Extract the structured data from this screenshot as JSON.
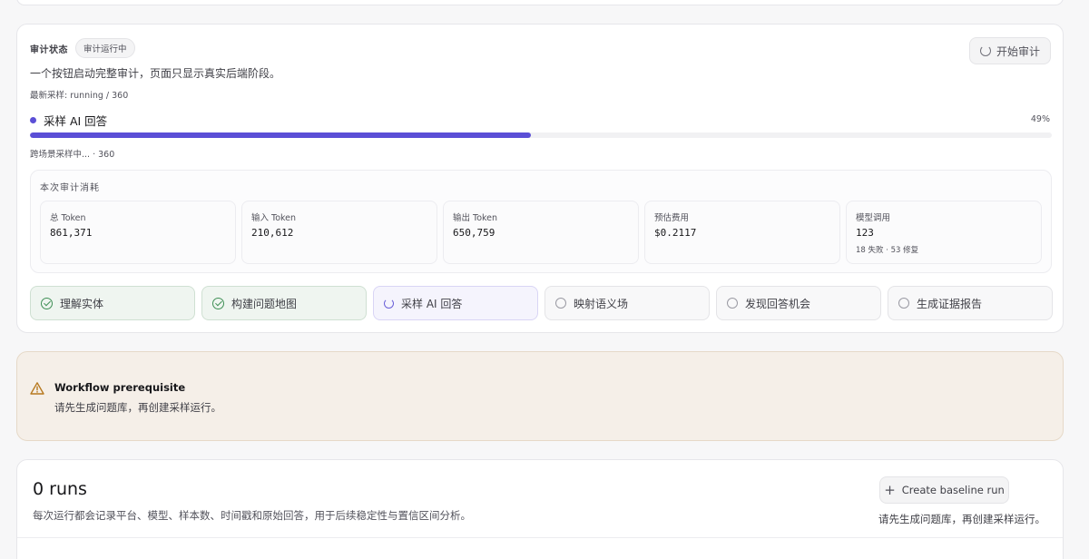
{
  "audit": {
    "status_label": "审计状态",
    "status_badge": "审计运行中",
    "start_button": "开始审计",
    "description": "一个按钮启动完整审计，页面只显示真实后端阶段。",
    "latest_sample": "最新采样: running / 360",
    "current_step": "采样 AI 回答",
    "progress_percent_text": "49%",
    "progress_fraction": 0.49,
    "progress_sub": "跨场景采样中... · 360",
    "consumption": {
      "title": "本次审计消耗",
      "metrics": [
        {
          "label": "总 Token",
          "value": "861,371",
          "sub": ""
        },
        {
          "label": "输入 Token",
          "value": "210,612",
          "sub": ""
        },
        {
          "label": "输出 Token",
          "value": "650,759",
          "sub": ""
        },
        {
          "label": "预估费用",
          "value": "$0.2117",
          "sub": ""
        },
        {
          "label": "模型调用",
          "value": "123",
          "sub": "18 失败 · 53 修复"
        }
      ]
    },
    "steps": [
      {
        "label": "理解实体",
        "state": "done",
        "icon": "check-circle-icon"
      },
      {
        "label": "构建问题地图",
        "state": "done",
        "icon": "check-circle-icon"
      },
      {
        "label": "采样 AI 回答",
        "state": "active",
        "icon": "spinner-icon"
      },
      {
        "label": "映射语义场",
        "state": "pending",
        "icon": "empty-circle-icon"
      },
      {
        "label": "发现回答机会",
        "state": "pending",
        "icon": "empty-circle-icon"
      },
      {
        "label": "生成证据报告",
        "state": "pending",
        "icon": "empty-circle-icon"
      }
    ]
  },
  "prerequisite": {
    "title": "Workflow prerequisite",
    "text": "请先生成问题库，再创建采样运行。",
    "icon": "warning-triangle-icon"
  },
  "runs": {
    "title": "0 runs",
    "description": "每次运行都会记录平台、模型、样本数、时间戳和原始回答，用于后续稳定性与置信区间分析。",
    "create_button": "Create baseline run",
    "note": "请先生成问题库，再创建采样运行。"
  },
  "colors": {
    "accent": "#5b4fd6",
    "done": "#3f8f55",
    "warning": "#b7791f",
    "warning_bg": "#f5efe8"
  }
}
